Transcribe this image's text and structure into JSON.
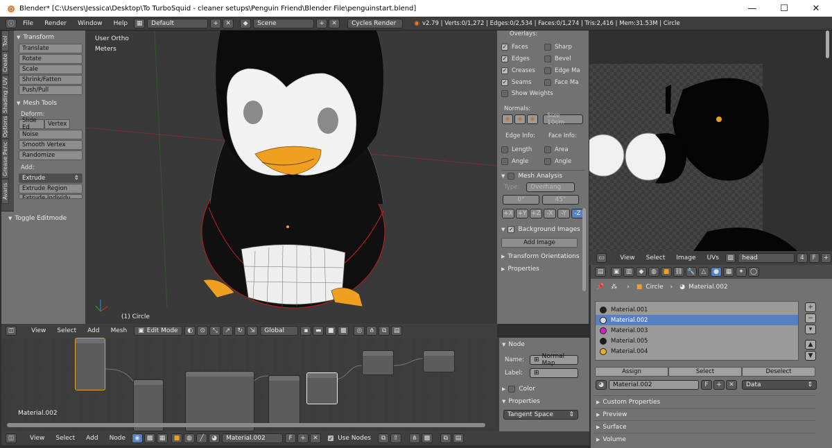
{
  "window": {
    "title": "Blender* [C:\\Users\\Jessica\\Desktop\\To TurboSquid - cleaner setups\\Penguin Friend\\Blender File\\penguinstart.blend]",
    "min": "—",
    "max": "☐",
    "close": "✕"
  },
  "info_bar": {
    "menus": [
      "File",
      "Render",
      "Window",
      "Help"
    ],
    "layout": "Default",
    "scene": "Scene",
    "engine": "Cycles Render",
    "stats": "v2.79 | Verts:0/1,272 | Edges:0/2,534 | Faces:0/1,274 | Tris:2,416 | Mem:31.53M | Circle"
  },
  "tool_shelf": {
    "tabs": [
      "Tool",
      "Create",
      "Shading / UV",
      "Options",
      "Grease Penc",
      "Avaris"
    ],
    "transform": {
      "header": "Transform",
      "buttons": [
        "Translate",
        "Rotate",
        "Scale",
        "Shrink/Fatten",
        "Push/Pull"
      ]
    },
    "mesh_tools": {
      "header": "Mesh Tools",
      "deform_label": "Deform:",
      "slide_edge": "Slide Ed",
      "vertex": "Vertex",
      "buttons": [
        "Noise",
        "Smooth Vertex",
        "Randomize"
      ],
      "add_label": "Add:",
      "extrude": "Extrude",
      "extrude_region": "Extrude Region",
      "extrude_individual": "Extrude Individu"
    },
    "toggle": "Toggle Editmode"
  },
  "viewport": {
    "view_label": "User Ortho",
    "units": "Meters",
    "object": "(1) Circle",
    "header": {
      "menus": [
        "View",
        "Select",
        "Add",
        "Mesh"
      ],
      "mode": "Edit Mode",
      "orientation": "Global"
    }
  },
  "properties_panel": {
    "overlays": "Overlays:",
    "checks_left": [
      {
        "label": "Faces",
        "on": true
      },
      {
        "label": "Edges",
        "on": true
      },
      {
        "label": "Creases",
        "on": true
      },
      {
        "label": "Seams",
        "on": true
      }
    ],
    "checks_right": [
      {
        "label": "Sharp",
        "on": false
      },
      {
        "label": "Bevel",
        "on": false
      },
      {
        "label": "Edge Ma",
        "on": false
      },
      {
        "label": "Face Ma",
        "on": false
      }
    ],
    "show_weights": "Show Weights",
    "normals": "Normals:",
    "size": "Size 10cm",
    "edge_info": "Edge Info:",
    "face_info": "Face Info:",
    "length": "Length",
    "area": "Area",
    "angle1": "Angle",
    "angle2": "Angle",
    "mesh_analysis": "Mesh Analysis",
    "type_label": "Type:",
    "type_value": "Overhang",
    "deg0": "0°",
    "deg45": "45°",
    "axes": [
      "+X",
      "+Y",
      "+Z",
      "-X",
      "-Y",
      "-Z"
    ],
    "background_images": "Background Images",
    "add_image": "Add Image",
    "transform_orientations": "Transform Orientations",
    "properties": "Properties"
  },
  "uv_editor": {
    "header": {
      "menus": [
        "View",
        "Select",
        "Image",
        "UVs"
      ],
      "image": "head",
      "users": "4",
      "fake": "F"
    }
  },
  "material_panel": {
    "breadcrumb_object": "Circle",
    "breadcrumb_material": "Material.002",
    "materials": [
      {
        "name": "Material.001",
        "color": "#222222"
      },
      {
        "name": "Material.002",
        "color": "#dddddd"
      },
      {
        "name": "Material.003",
        "color": "#d020c8"
      },
      {
        "name": "Material.005",
        "color": "#1a1a1a"
      },
      {
        "name": "Material.004",
        "color": "#e0b030"
      }
    ],
    "selected_index": 1,
    "assign": "Assign",
    "select": "Select",
    "deselect": "Deselect",
    "material_field": "Material.002",
    "fake": "F",
    "link": "Data",
    "sections": [
      "Custom Properties",
      "Preview",
      "Surface",
      "Volume"
    ]
  },
  "node_editor": {
    "material_label": "Material.002",
    "header": {
      "menus": [
        "View",
        "Select",
        "Add",
        "Node"
      ],
      "material": "Material.002",
      "fake": "F",
      "use_nodes": "Use Nodes"
    }
  },
  "node_sidebar": {
    "node_header": "Node",
    "name_label": "Name:",
    "name_value": "Normal Map",
    "label_label": "Label:",
    "color": "Color",
    "properties": "Properties",
    "space": "Tangent Space"
  },
  "colors": {
    "selected": "#5680c2",
    "viewport": "#393939",
    "panel": "#727272",
    "orange": "#f0a020"
  }
}
